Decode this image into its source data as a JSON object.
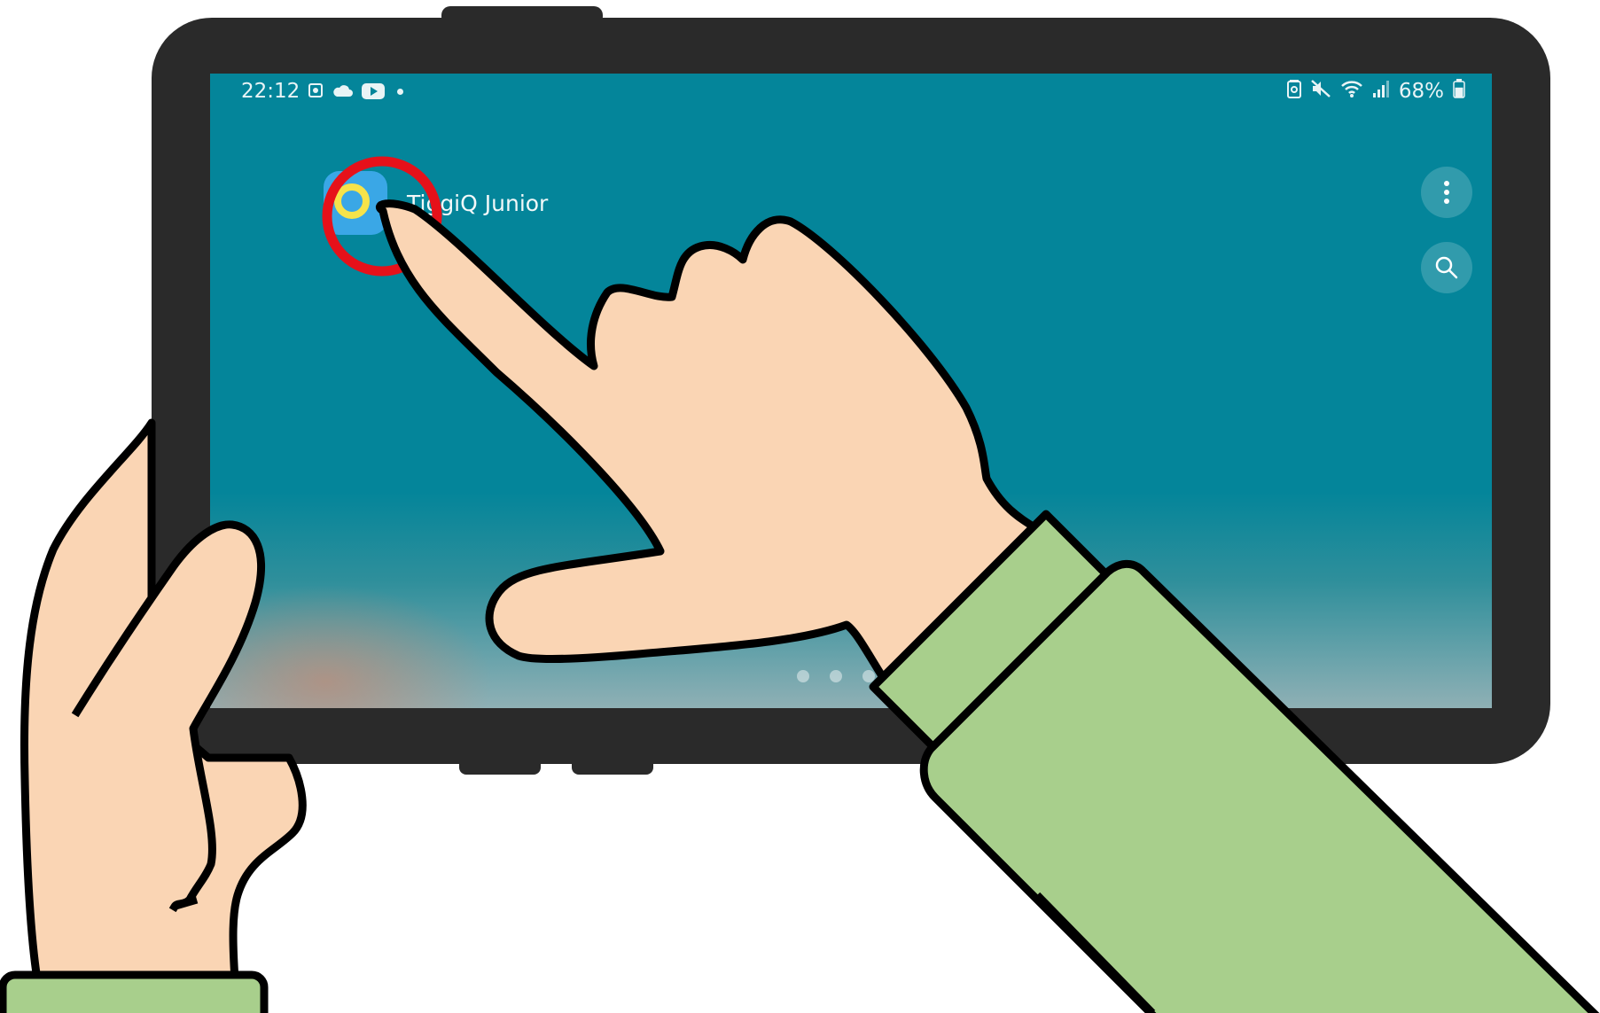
{
  "status_bar": {
    "time": "22:12",
    "left_icons": [
      "screenshot-icon",
      "cloud-icon",
      "youtube-icon",
      "dot-icon"
    ],
    "right_icons": [
      "battery-saver-icon",
      "mute-icon",
      "wifi-icon",
      "signal-icon"
    ],
    "battery_text": "68%",
    "battery_level": 0.68
  },
  "app": {
    "label": "TiggiQ Junior",
    "icon": "tiggiq-app-icon"
  },
  "side_buttons": [
    {
      "name": "menu-button",
      "icon": "more-vertical-icon"
    },
    {
      "name": "search-button",
      "icon": "search-icon"
    }
  ],
  "page_indicator": {
    "count": 3
  },
  "colors": {
    "screen": "#04859a",
    "device_frame": "#2a2a2a",
    "skin": "#fad5b4",
    "sleeve": "#a8cf8c",
    "outline": "#000000",
    "highlight_ring": "#e6111a",
    "app_icon_bg": "#3aa7e6",
    "app_icon_q": "#f6e34a"
  },
  "annotation": {
    "type": "tap-highlight-circle"
  }
}
